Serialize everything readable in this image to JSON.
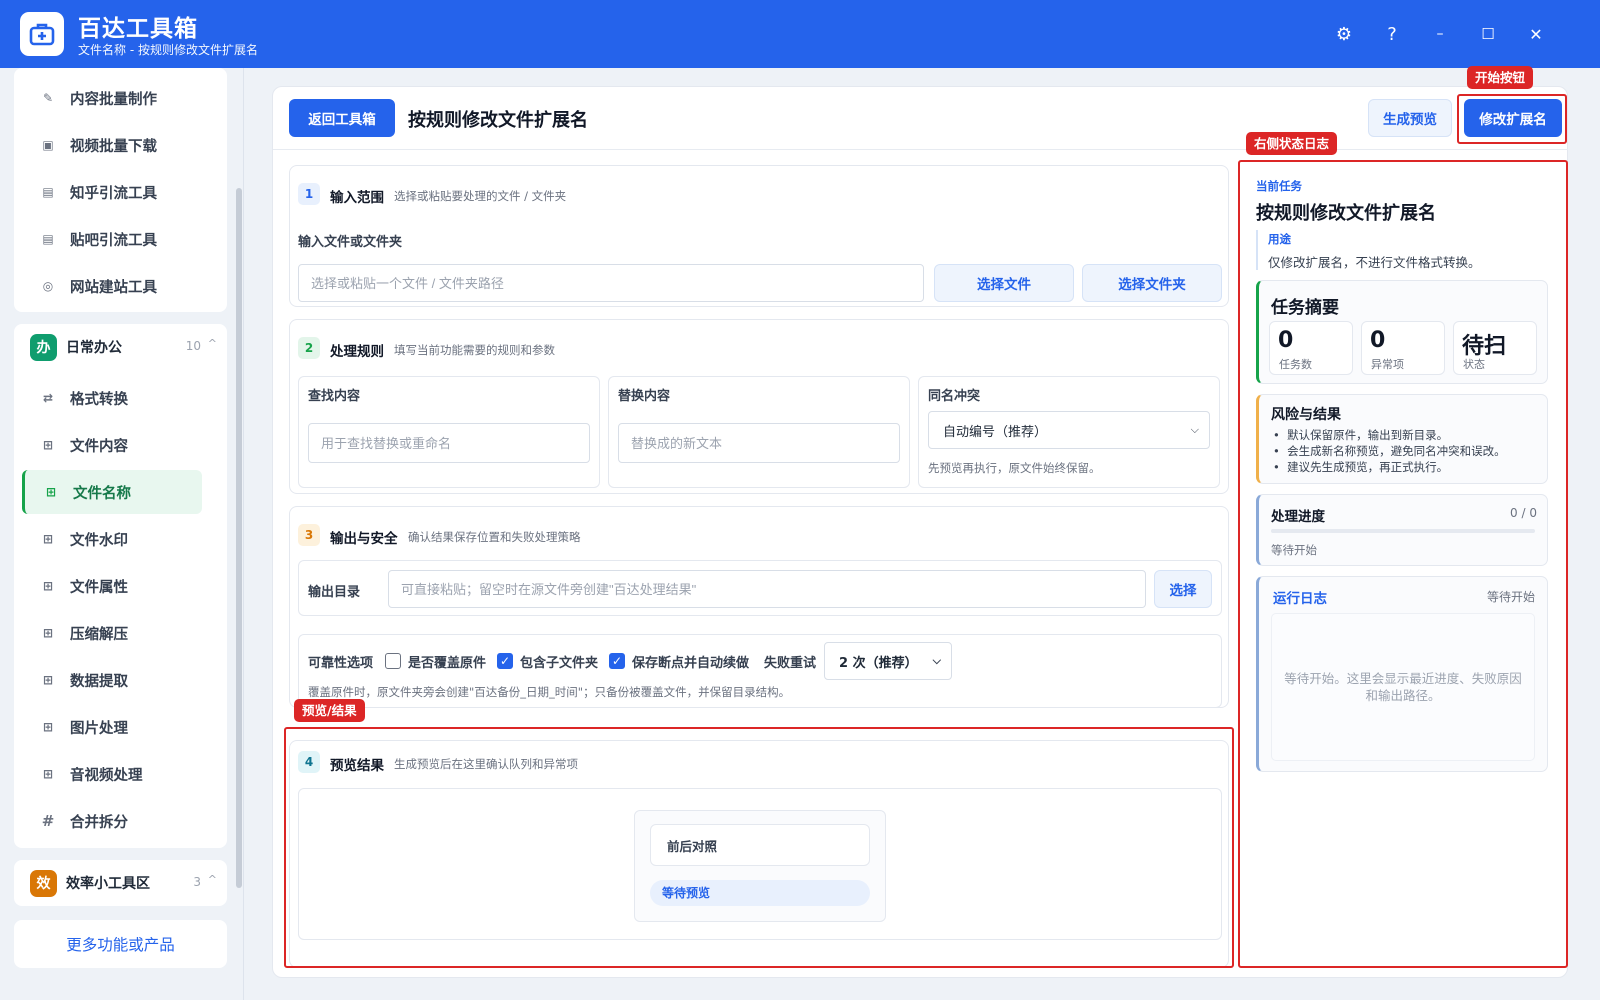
{
  "app": {
    "title": "百达工具箱",
    "subtitle": "文件名称 - 按规则修改文件扩展名"
  },
  "window_controls": {
    "settings": "⚙",
    "help": "?",
    "minimize": "–",
    "maximize": "☐",
    "close": "✕"
  },
  "sidebar": {
    "top_items": [
      {
        "label": "内容批量制作",
        "icon": "✎"
      },
      {
        "label": "视频批量下载",
        "icon": "▣"
      },
      {
        "label": "知乎引流工具",
        "icon": "▤"
      },
      {
        "label": "贴吧引流工具",
        "icon": "▤"
      },
      {
        "label": "网站建站工具",
        "icon": "◎"
      }
    ],
    "group_office": {
      "badge": "办",
      "name": "日常办公",
      "count": "10",
      "caret": "^",
      "items": [
        {
          "label": "格式转换",
          "icon": "⇄"
        },
        {
          "label": "文件内容",
          "icon": "⊞"
        },
        {
          "label": "文件名称",
          "icon": "⊞"
        },
        {
          "label": "文件水印",
          "icon": "⊞"
        },
        {
          "label": "文件属性",
          "icon": "⊞"
        },
        {
          "label": "压缩解压",
          "icon": "⊞"
        },
        {
          "label": "数据提取",
          "icon": "⊞"
        },
        {
          "label": "图片处理",
          "icon": "⊞"
        },
        {
          "label": "音视频处理",
          "icon": "⊞"
        },
        {
          "label": "合并拆分",
          "icon": "#"
        }
      ]
    },
    "group_efficiency": {
      "badge": "效",
      "name": "效率小工具区",
      "count": "3",
      "caret": "^"
    },
    "more_link": "更多功能或产品"
  },
  "header": {
    "back_button": "返回工具箱",
    "title": "按规则修改文件扩展名",
    "preview_button": "生成预览",
    "start_button": "修改扩展名"
  },
  "annotations": {
    "start_button_tag": "开始按钮",
    "right_log_tag": "右侧状态日志",
    "preview_tag": "预览/结果"
  },
  "section1": {
    "num": "1",
    "title": "输入范围",
    "desc": "选择或粘贴要处理的文件 / 文件夹",
    "field_label": "输入文件或文件夹",
    "placeholder": "选择或粘贴一个文件 / 文件夹路径",
    "choose_file": "选择文件",
    "choose_folder": "选择文件夹"
  },
  "section2": {
    "num": "2",
    "title": "处理规则",
    "desc": "填写当前功能需要的规则和参数",
    "find_label": "查找内容",
    "find_placeholder": "用于查找替换或重命名",
    "replace_label": "替换内容",
    "replace_placeholder": "替换成的新文本",
    "conflict_label": "同名冲突",
    "conflict_value": "自动编号（推荐）",
    "conflict_hint": "先预览再执行，原文件始终保留。"
  },
  "section3": {
    "num": "3",
    "title": "输出与安全",
    "desc": "确认结果保存位置和失败处理策略",
    "output_label": "输出目录",
    "output_placeholder": "可直接粘贴；留空时在源文件旁创建\"百达处理结果\"",
    "choose_button": "选择",
    "reliability_label": "可靠性选项",
    "overwrite_label": "是否覆盖原件",
    "overwrite_checked": false,
    "subfolder_label": "包含子文件夹",
    "subfolder_checked": true,
    "resume_label": "保存断点并自动续做",
    "resume_checked": true,
    "retry_label": "失败重试",
    "retry_value": "2 次（推荐）",
    "hint": "覆盖原件时，原文件夹旁会创建\"百达备份_日期_时间\"；只备份被覆盖文件，并保留目录结构。"
  },
  "section4": {
    "num": "4",
    "title": "预览结果",
    "desc": "生成预览后在这里确认队列和异常项",
    "compare_label": "前后对照",
    "status_pill": "等待预览"
  },
  "right_panel": {
    "current_task_label": "当前任务",
    "task_title": "按规则修改文件扩展名",
    "usage_label": "用途",
    "usage_text": "仅修改扩展名，不进行文件格式转换。",
    "summary_title": "任务摘要",
    "stats": [
      {
        "value": "0",
        "label": "任务数"
      },
      {
        "value": "0",
        "label": "异常项"
      },
      {
        "value": "待扫",
        "label": "状态"
      }
    ],
    "risk_title": "风险与结果",
    "risk_items": [
      "默认保留原件，输出到新目录。",
      "会生成新名称预览，避免同名冲突和误改。",
      "建议先生成预览，再正式执行。"
    ],
    "progress_title": "处理进度",
    "progress_count": "0 / 0",
    "progress_fraction": 0,
    "progress_status": "等待开始",
    "log_title": "运行日志",
    "log_status": "等待开始",
    "log_empty": "等待开始。这里会显示最近进度、失败原因和输出路径。"
  },
  "colors": {
    "primary": "#2563eb",
    "active_green": "#16a34a",
    "annotation_red": "#dc2626",
    "office_badge": "#0f9d6e",
    "efficiency_badge": "#d97706"
  }
}
